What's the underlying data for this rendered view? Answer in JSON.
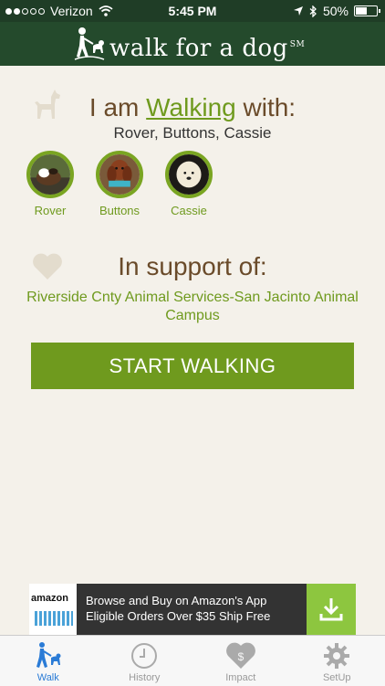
{
  "status_bar": {
    "carrier": "Verizon",
    "time": "5:45 PM",
    "battery": "50%"
  },
  "header": {
    "logo_text": "walk for a dog",
    "logo_mark": "SM"
  },
  "walk": {
    "prefix": "I am",
    "link": "Walking",
    "suffix": "with:",
    "dogs_summary": "Rover, Buttons, Cassie",
    "dogs": [
      {
        "name": "Rover"
      },
      {
        "name": "Buttons"
      },
      {
        "name": "Cassie"
      }
    ]
  },
  "support": {
    "title": "In support of:",
    "organization": "Riverside Cnty Animal Services-San Jacinto Animal Campus"
  },
  "start_button": "START WALKING",
  "ad": {
    "brand": "amazon",
    "line1": "Browse and Buy on Amazon's App",
    "line2": "Eligible Orders Over $35 Ship Free"
  },
  "tabs": [
    {
      "label": "Walk",
      "icon": "walk-icon",
      "active": true
    },
    {
      "label": "History",
      "icon": "clock-icon",
      "active": false
    },
    {
      "label": "Impact",
      "icon": "heart-dollar-icon",
      "active": false
    },
    {
      "label": "SetUp",
      "icon": "gear-icon",
      "active": false
    }
  ],
  "colors": {
    "brand_green": "#244a2c",
    "accent_green": "#6f9a1e",
    "brown": "#6a4b2a",
    "tab_active": "#2a7bd6"
  }
}
